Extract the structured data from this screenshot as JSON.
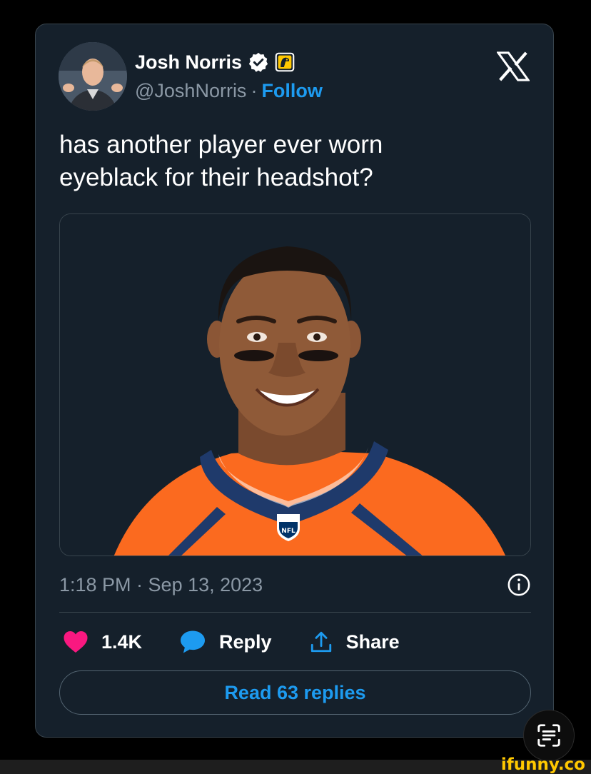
{
  "author": {
    "name": "Josh Norris",
    "handle": "@JoshNorris",
    "separator": "·",
    "follow_label": "Follow"
  },
  "tweet": {
    "text": "has another player ever worn\neyeblack for their headshot?",
    "timestamp": "1:18 PM · Sep 13, 2023"
  },
  "actions": {
    "likes": "1.4K",
    "reply_label": "Reply",
    "share_label": "Share"
  },
  "read_replies_label": "Read 63 replies",
  "watermark": "ifunny.co",
  "icons": {
    "verified": "verified-badge-icon",
    "affiliation": "affiliation-badge-icon",
    "brand": "x-logo-icon",
    "info": "info-icon",
    "like": "heart-icon",
    "reply": "speech-bubble-icon",
    "share": "share-icon",
    "lens": "text-scan-icon"
  },
  "colors": {
    "card_bg": "#15202b",
    "accent": "#1d9bf0",
    "like": "#f91880",
    "secondary_text": "#8b98a5",
    "jersey": "#fb6a1f",
    "trim": "#1f3a6b"
  }
}
